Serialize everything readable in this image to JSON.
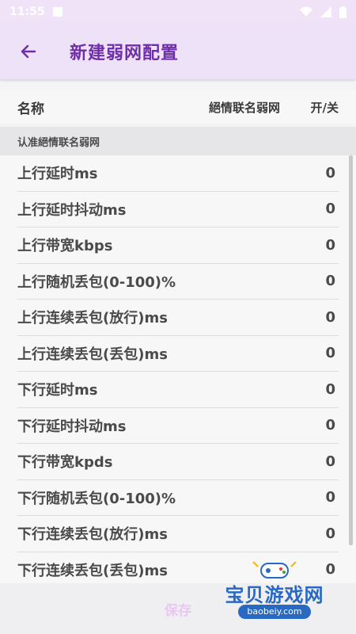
{
  "status_bar": {
    "time": "11:55"
  },
  "app_bar": {
    "title": "新建弱网配置"
  },
  "table_header": {
    "name_label": "名称",
    "preset_label": "絕情联名弱网",
    "toggle_label": "开/关"
  },
  "section": {
    "label": "认准絕情联名弱网"
  },
  "rows": [
    {
      "label": "上行延时ms",
      "value": "0"
    },
    {
      "label": "上行延时抖动ms",
      "value": "0"
    },
    {
      "label": "上行带宽kbps",
      "value": "0"
    },
    {
      "label": "上行随机丢包(0-100)%",
      "value": "0"
    },
    {
      "label": "上行连续丢包(放行)ms",
      "value": "0"
    },
    {
      "label": "上行连续丢包(丢包)ms",
      "value": "0"
    },
    {
      "label": "下行延时ms",
      "value": "0"
    },
    {
      "label": "下行延时抖动ms",
      "value": "0"
    },
    {
      "label": "下行带宽kpds",
      "value": "0"
    },
    {
      "label": "下行随机丢包(0-100)%",
      "value": "0"
    },
    {
      "label": "下行连续丢包(放行)ms",
      "value": "0"
    },
    {
      "label": "下行连续丢包(丢包)ms",
      "value": "0"
    }
  ],
  "footer": {
    "save_label": "保存"
  },
  "watermark": {
    "title": "宝贝游戏网",
    "url": "baobeiy.com"
  },
  "colors": {
    "accent": "#6f2fa8",
    "appbar_bg": "#eee2f9"
  }
}
